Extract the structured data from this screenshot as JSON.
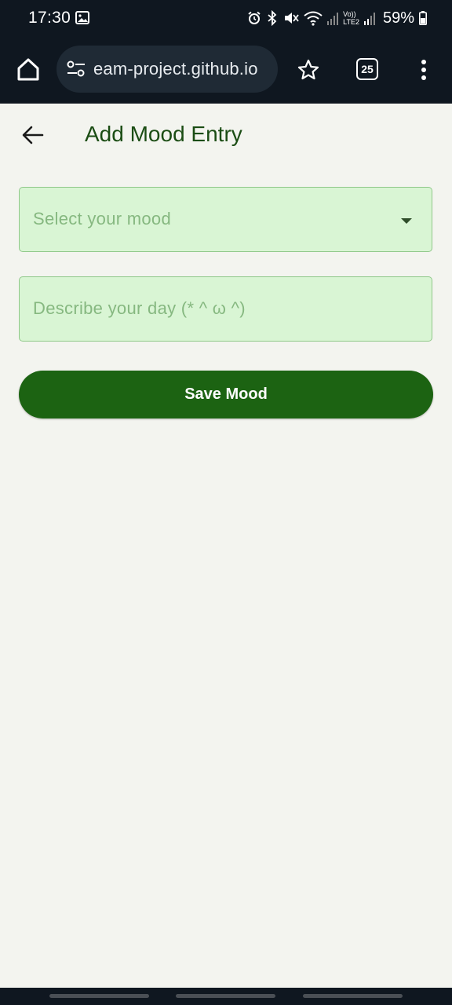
{
  "status_bar": {
    "time": "17:30",
    "battery": "59%",
    "network_label_top": "Vo))",
    "network_label_bottom": "LTE2",
    "icons": [
      "image-icon",
      "alarm-icon",
      "bluetooth-icon",
      "mute-icon",
      "wifi-icon",
      "signal-icon",
      "battery-icon"
    ]
  },
  "browser": {
    "url": "eam-project.github.io",
    "tab_count": "25",
    "icons": [
      "home-icon",
      "site-settings-icon",
      "star-icon",
      "tabs-icon",
      "more-vert-icon"
    ]
  },
  "header": {
    "title": "Add Mood Entry",
    "back_icon": "arrow-back-icon"
  },
  "form": {
    "mood_select": {
      "placeholder": "Select your mood",
      "value": ""
    },
    "day_input": {
      "placeholder": "Describe your day (* ^ ω ^)",
      "value": ""
    },
    "save_label": "Save Mood"
  },
  "colors": {
    "primary": "#1c6312",
    "title": "#1b4d14",
    "field_fill": "#d9f5d4",
    "field_border": "#8fc889",
    "background": "#f3f4ef",
    "system_bar": "#0f1720"
  }
}
